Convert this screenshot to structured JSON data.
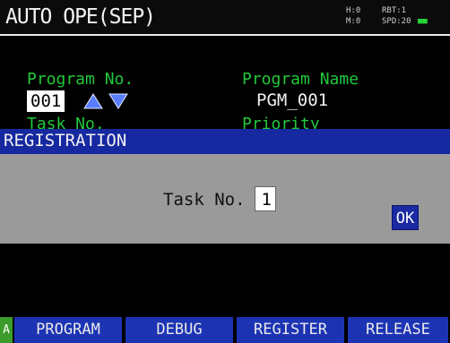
{
  "screen": {
    "title": "AUTO OPE(SEP)",
    "status": {
      "row1_a": "H:0",
      "row1_b": "RBT:1",
      "row1_c": "",
      "row2_a": "M:0",
      "row2_b": "SPD:20",
      "row2_c": "■■"
    }
  },
  "program": {
    "number_label": "Program No.",
    "number_value": "001",
    "name_label": "Program Name",
    "name_value": "PGM_001",
    "partial_left": "Task No.",
    "partial_right": "Priority"
  },
  "dialog": {
    "title": "REGISTRATION",
    "task_label": "Task No.",
    "task_value": "1",
    "ok_label": "OK"
  },
  "function_keys": {
    "indicator": "A",
    "f1": "PROGRAM",
    "f2": "DEBUG",
    "f3": "REGISTER",
    "f4": "RELEASE"
  },
  "colors": {
    "dialog_header": "#1629a0",
    "dialog_body": "#9a9a9a",
    "label_green": "#22c83a",
    "fkey_blue": "#1c34b4",
    "arrow_blue": "#3a5bff"
  },
  "icons": {
    "up": "triangle-up-icon",
    "down": "triangle-down-icon"
  }
}
